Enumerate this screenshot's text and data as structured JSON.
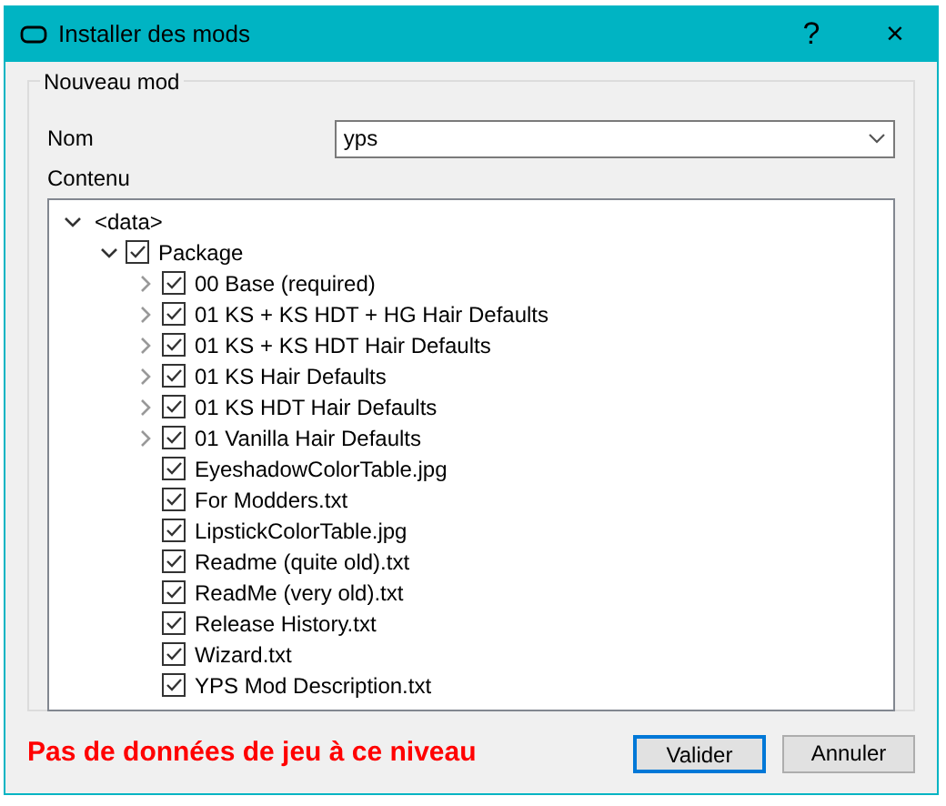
{
  "window": {
    "title": "Installer des mods",
    "buttons": [
      "?",
      "×"
    ]
  },
  "group": {
    "title": "Nouveau mod",
    "name_label": "Nom",
    "name_value": "yps",
    "content_label": "Contenu"
  },
  "tree": [
    {
      "label": "<data>",
      "expanded": true,
      "children": [
        {
          "label": "Package",
          "expanded": true,
          "checked": true,
          "children": [
            {
              "label": "00 Base (required)",
              "expanded": false,
              "checked": true
            },
            {
              "label": "01 KS + KS HDT + HG Hair Defaults",
              "expanded": false,
              "checked": true
            },
            {
              "label": "01 KS + KS HDT Hair Defaults",
              "expanded": false,
              "checked": true
            },
            {
              "label": "01 KS Hair Defaults",
              "expanded": false,
              "checked": true
            },
            {
              "label": "01 KS HDT Hair Defaults",
              "expanded": false,
              "checked": true
            },
            {
              "label": "01 Vanilla Hair Defaults",
              "expanded": false,
              "checked": true
            },
            {
              "label": "EyeshadowColorTable.jpg",
              "checked": true
            },
            {
              "label": "For Modders.txt",
              "checked": true
            },
            {
              "label": "LipstickColorTable.jpg",
              "checked": true
            },
            {
              "label": "Readme (quite old).txt",
              "checked": true
            },
            {
              "label": "ReadMe (very old).txt",
              "checked": true
            },
            {
              "label": "Release History.txt",
              "checked": true
            },
            {
              "label": "Wizard.txt",
              "checked": true
            },
            {
              "label": "YPS Mod Description.txt",
              "checked": true
            }
          ]
        }
      ]
    }
  ],
  "warning": "Pas de données de jeu à ce niveau",
  "buttons": [
    {
      "label": "Valider",
      "selected": true
    },
    {
      "label": "Annuler",
      "selected": false
    }
  ]
}
